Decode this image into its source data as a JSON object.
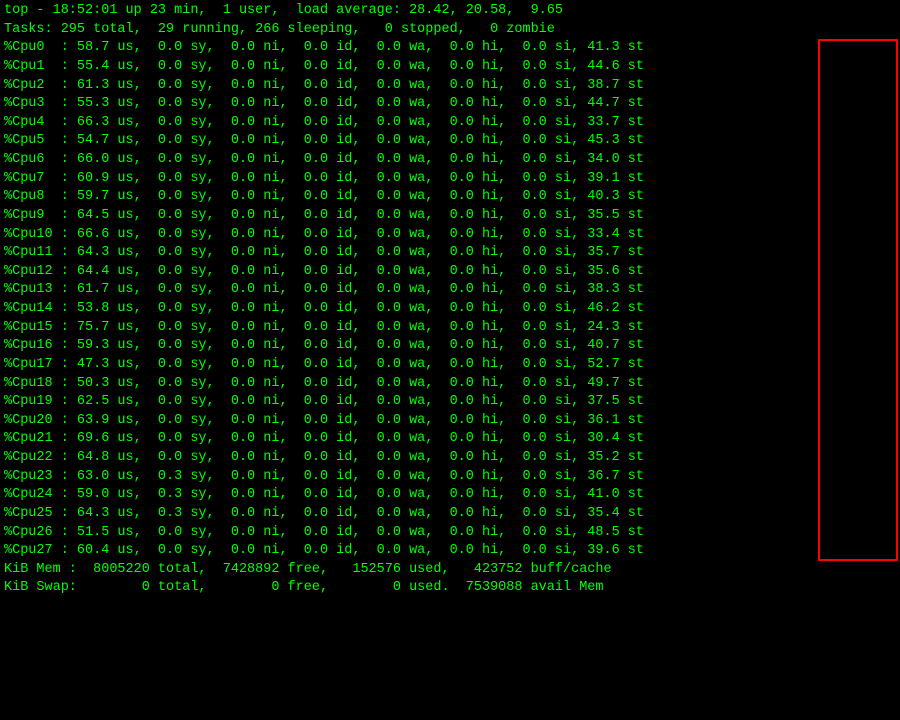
{
  "header": {
    "top_line": "top - 18:52:01 up 23 min,  1 user,  load average: 28.42, 20.58,  9.65",
    "tasks_line": "Tasks: 295 total,  29 running, 266 sleeping,   0 stopped,   0 zombie"
  },
  "cpus": [
    {
      "name": "%Cpu0",
      "us": "58.7",
      "sy": "0.0",
      "ni": "0.0",
      "id": "0.0",
      "wa": "0.0",
      "hi": "0.0",
      "si": "0.0",
      "st": "41.3"
    },
    {
      "name": "%Cpu1",
      "us": "55.4",
      "sy": "0.0",
      "ni": "0.0",
      "id": "0.0",
      "wa": "0.0",
      "hi": "0.0",
      "si": "0.0",
      "st": "44.6"
    },
    {
      "name": "%Cpu2",
      "us": "61.3",
      "sy": "0.0",
      "ni": "0.0",
      "id": "0.0",
      "wa": "0.0",
      "hi": "0.0",
      "si": "0.0",
      "st": "38.7"
    },
    {
      "name": "%Cpu3",
      "us": "55.3",
      "sy": "0.0",
      "ni": "0.0",
      "id": "0.0",
      "wa": "0.0",
      "hi": "0.0",
      "si": "0.0",
      "st": "44.7"
    },
    {
      "name": "%Cpu4",
      "us": "66.3",
      "sy": "0.0",
      "ni": "0.0",
      "id": "0.0",
      "wa": "0.0",
      "hi": "0.0",
      "si": "0.0",
      "st": "33.7"
    },
    {
      "name": "%Cpu5",
      "us": "54.7",
      "sy": "0.0",
      "ni": "0.0",
      "id": "0.0",
      "wa": "0.0",
      "hi": "0.0",
      "si": "0.0",
      "st": "45.3"
    },
    {
      "name": "%Cpu6",
      "us": "66.0",
      "sy": "0.0",
      "ni": "0.0",
      "id": "0.0",
      "wa": "0.0",
      "hi": "0.0",
      "si": "0.0",
      "st": "34.0"
    },
    {
      "name": "%Cpu7",
      "us": "60.9",
      "sy": "0.0",
      "ni": "0.0",
      "id": "0.0",
      "wa": "0.0",
      "hi": "0.0",
      "si": "0.0",
      "st": "39.1"
    },
    {
      "name": "%Cpu8",
      "us": "59.7",
      "sy": "0.0",
      "ni": "0.0",
      "id": "0.0",
      "wa": "0.0",
      "hi": "0.0",
      "si": "0.0",
      "st": "40.3"
    },
    {
      "name": "%Cpu9",
      "us": "64.5",
      "sy": "0.0",
      "ni": "0.0",
      "id": "0.0",
      "wa": "0.0",
      "hi": "0.0",
      "si": "0.0",
      "st": "35.5"
    },
    {
      "name": "%Cpu10",
      "us": "66.6",
      "sy": "0.0",
      "ni": "0.0",
      "id": "0.0",
      "wa": "0.0",
      "hi": "0.0",
      "si": "0.0",
      "st": "33.4"
    },
    {
      "name": "%Cpu11",
      "us": "64.3",
      "sy": "0.0",
      "ni": "0.0",
      "id": "0.0",
      "wa": "0.0",
      "hi": "0.0",
      "si": "0.0",
      "st": "35.7"
    },
    {
      "name": "%Cpu12",
      "us": "64.4",
      "sy": "0.0",
      "ni": "0.0",
      "id": "0.0",
      "wa": "0.0",
      "hi": "0.0",
      "si": "0.0",
      "st": "35.6"
    },
    {
      "name": "%Cpu13",
      "us": "61.7",
      "sy": "0.0",
      "ni": "0.0",
      "id": "0.0",
      "wa": "0.0",
      "hi": "0.0",
      "si": "0.0",
      "st": "38.3"
    },
    {
      "name": "%Cpu14",
      "us": "53.8",
      "sy": "0.0",
      "ni": "0.0",
      "id": "0.0",
      "wa": "0.0",
      "hi": "0.0",
      "si": "0.0",
      "st": "46.2"
    },
    {
      "name": "%Cpu15",
      "us": "75.7",
      "sy": "0.0",
      "ni": "0.0",
      "id": "0.0",
      "wa": "0.0",
      "hi": "0.0",
      "si": "0.0",
      "st": "24.3"
    },
    {
      "name": "%Cpu16",
      "us": "59.3",
      "sy": "0.0",
      "ni": "0.0",
      "id": "0.0",
      "wa": "0.0",
      "hi": "0.0",
      "si": "0.0",
      "st": "40.7"
    },
    {
      "name": "%Cpu17",
      "us": "47.3",
      "sy": "0.0",
      "ni": "0.0",
      "id": "0.0",
      "wa": "0.0",
      "hi": "0.0",
      "si": "0.0",
      "st": "52.7"
    },
    {
      "name": "%Cpu18",
      "us": "50.3",
      "sy": "0.0",
      "ni": "0.0",
      "id": "0.0",
      "wa": "0.0",
      "hi": "0.0",
      "si": "0.0",
      "st": "49.7"
    },
    {
      "name": "%Cpu19",
      "us": "62.5",
      "sy": "0.0",
      "ni": "0.0",
      "id": "0.0",
      "wa": "0.0",
      "hi": "0.0",
      "si": "0.0",
      "st": "37.5"
    },
    {
      "name": "%Cpu20",
      "us": "63.9",
      "sy": "0.0",
      "ni": "0.0",
      "id": "0.0",
      "wa": "0.0",
      "hi": "0.0",
      "si": "0.0",
      "st": "36.1"
    },
    {
      "name": "%Cpu21",
      "us": "69.6",
      "sy": "0.0",
      "ni": "0.0",
      "id": "0.0",
      "wa": "0.0",
      "hi": "0.0",
      "si": "0.0",
      "st": "30.4"
    },
    {
      "name": "%Cpu22",
      "us": "64.8",
      "sy": "0.0",
      "ni": "0.0",
      "id": "0.0",
      "wa": "0.0",
      "hi": "0.0",
      "si": "0.0",
      "st": "35.2"
    },
    {
      "name": "%Cpu23",
      "us": "63.0",
      "sy": "0.3",
      "ni": "0.0",
      "id": "0.0",
      "wa": "0.0",
      "hi": "0.0",
      "si": "0.0",
      "st": "36.7"
    },
    {
      "name": "%Cpu24",
      "us": "59.0",
      "sy": "0.3",
      "ni": "0.0",
      "id": "0.0",
      "wa": "0.0",
      "hi": "0.0",
      "si": "0.0",
      "st": "41.0"
    },
    {
      "name": "%Cpu25",
      "us": "64.3",
      "sy": "0.3",
      "ni": "0.0",
      "id": "0.0",
      "wa": "0.0",
      "hi": "0.0",
      "si": "0.0",
      "st": "35.4"
    },
    {
      "name": "%Cpu26",
      "us": "51.5",
      "sy": "0.0",
      "ni": "0.0",
      "id": "0.0",
      "wa": "0.0",
      "hi": "0.0",
      "si": "0.0",
      "st": "48.5"
    },
    {
      "name": "%Cpu27",
      "us": "60.4",
      "sy": "0.0",
      "ni": "0.0",
      "id": "0.0",
      "wa": "0.0",
      "hi": "0.0",
      "si": "0.0",
      "st": "39.6"
    }
  ],
  "mem": {
    "line": "KiB Mem :  8005220 total,  7428892 free,   152576 used,   423752 buff/cache"
  },
  "swap": {
    "line": "KiB Swap:        0 total,        0 free,        0 used.  7539088 avail Mem"
  }
}
